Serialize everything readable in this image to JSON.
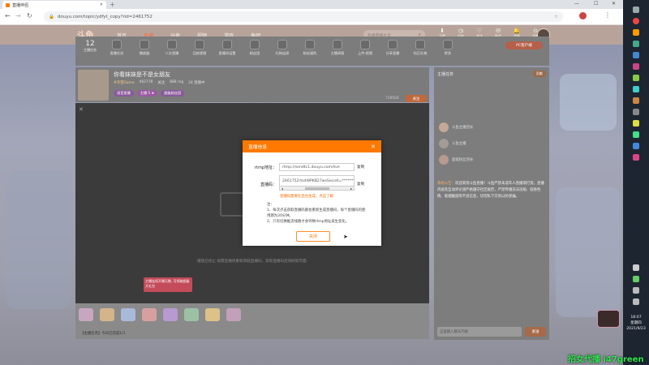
{
  "browser": {
    "tab_title": "直播伴侣",
    "url": "douyu.com/topic/ydfyt_copy?rid=2461752"
  },
  "site": {
    "logo": "斗鱼",
    "nav": [
      "首页",
      "直播",
      "分类",
      "视频",
      "游戏",
      "鱼吧"
    ],
    "search_placeholder": "鱼塘直播大全",
    "header_icons": [
      "下载",
      "历史",
      "关注",
      "私信",
      "消息",
      "开播"
    ]
  },
  "toolbar": {
    "count": "12",
    "count_label": "主播任务",
    "items": [
      "直播任务",
      "播放器",
      "二次直播",
      "回放视频",
      "直播间设置",
      "粉丝团",
      "礼物连接",
      "粉丝福利",
      "主播周报",
      "上传·视频",
      "分享直播",
      "钻石礼物",
      "更多"
    ],
    "pc_button": "PC客户端"
  },
  "stream": {
    "title": "你看妹妹是不是女朋友",
    "category": "#守望Game",
    "meta": [
      "462778",
      "关注",
      "888 rng",
      "24 直播中"
    ],
    "tags": [
      "语音直播",
      "主播 5 ★",
      "超级粉丝团"
    ],
    "follow_count": "739504",
    "follow_button": "关注",
    "live_button": "直播间",
    "badge": "自定义线上·1 先锋",
    "report": "举报",
    "more": "更多"
  },
  "modal": {
    "title": "直播信息",
    "rtmp_label": "rtmp地址：",
    "rtmp_value": "rtmp://sendtc1.douyu.com/live",
    "key_label": "直播码：",
    "key_value": "2461752rtsdWPKB27wsSecret=*******",
    "copy": "复制",
    "warning": "直播码需要在后台生成，点击了解",
    "notes_title": "注：",
    "note1": "1、每次点击获取直播码都会重新生成直播码，每个直播码的使用期为30分钟。",
    "note2": "2、只有切换推流线路才会导致rtmp地址发生变化。",
    "ok": "关闭"
  },
  "player": {
    "notice": "播放已停止 如需直播请重新获取直播码，获取直播码后请刷新页面"
  },
  "chat": {
    "rank_title": "主播任务",
    "welcome_btn": "贡献",
    "rules_title": "系统公告：",
    "rules_text": "欢迎来到斗鱼直播！斗鱼严禁未成年人直播或打赏。直播内容及互动评论须严格遵守社区规范，严禁传播违法违规、低俗色情、吸烟酗酒等不良信息，切勿私下交易以防受骗。",
    "users": [
      "斗鱼主播团长",
      "斗鱼主播",
      "超级粉丝团长"
    ],
    "input_placeholder": "这里输入聊天内容",
    "send": "发送"
  },
  "gift_banner": "主播连续开播天数, 可领取超级大礼包",
  "bottom_status": "【主播任务】今日已完成1/1",
  "taskbar": {
    "time": "18:07",
    "weekday": "星期四",
    "date": "2021/9/23"
  },
  "watermark": "招女代播 i47green"
}
